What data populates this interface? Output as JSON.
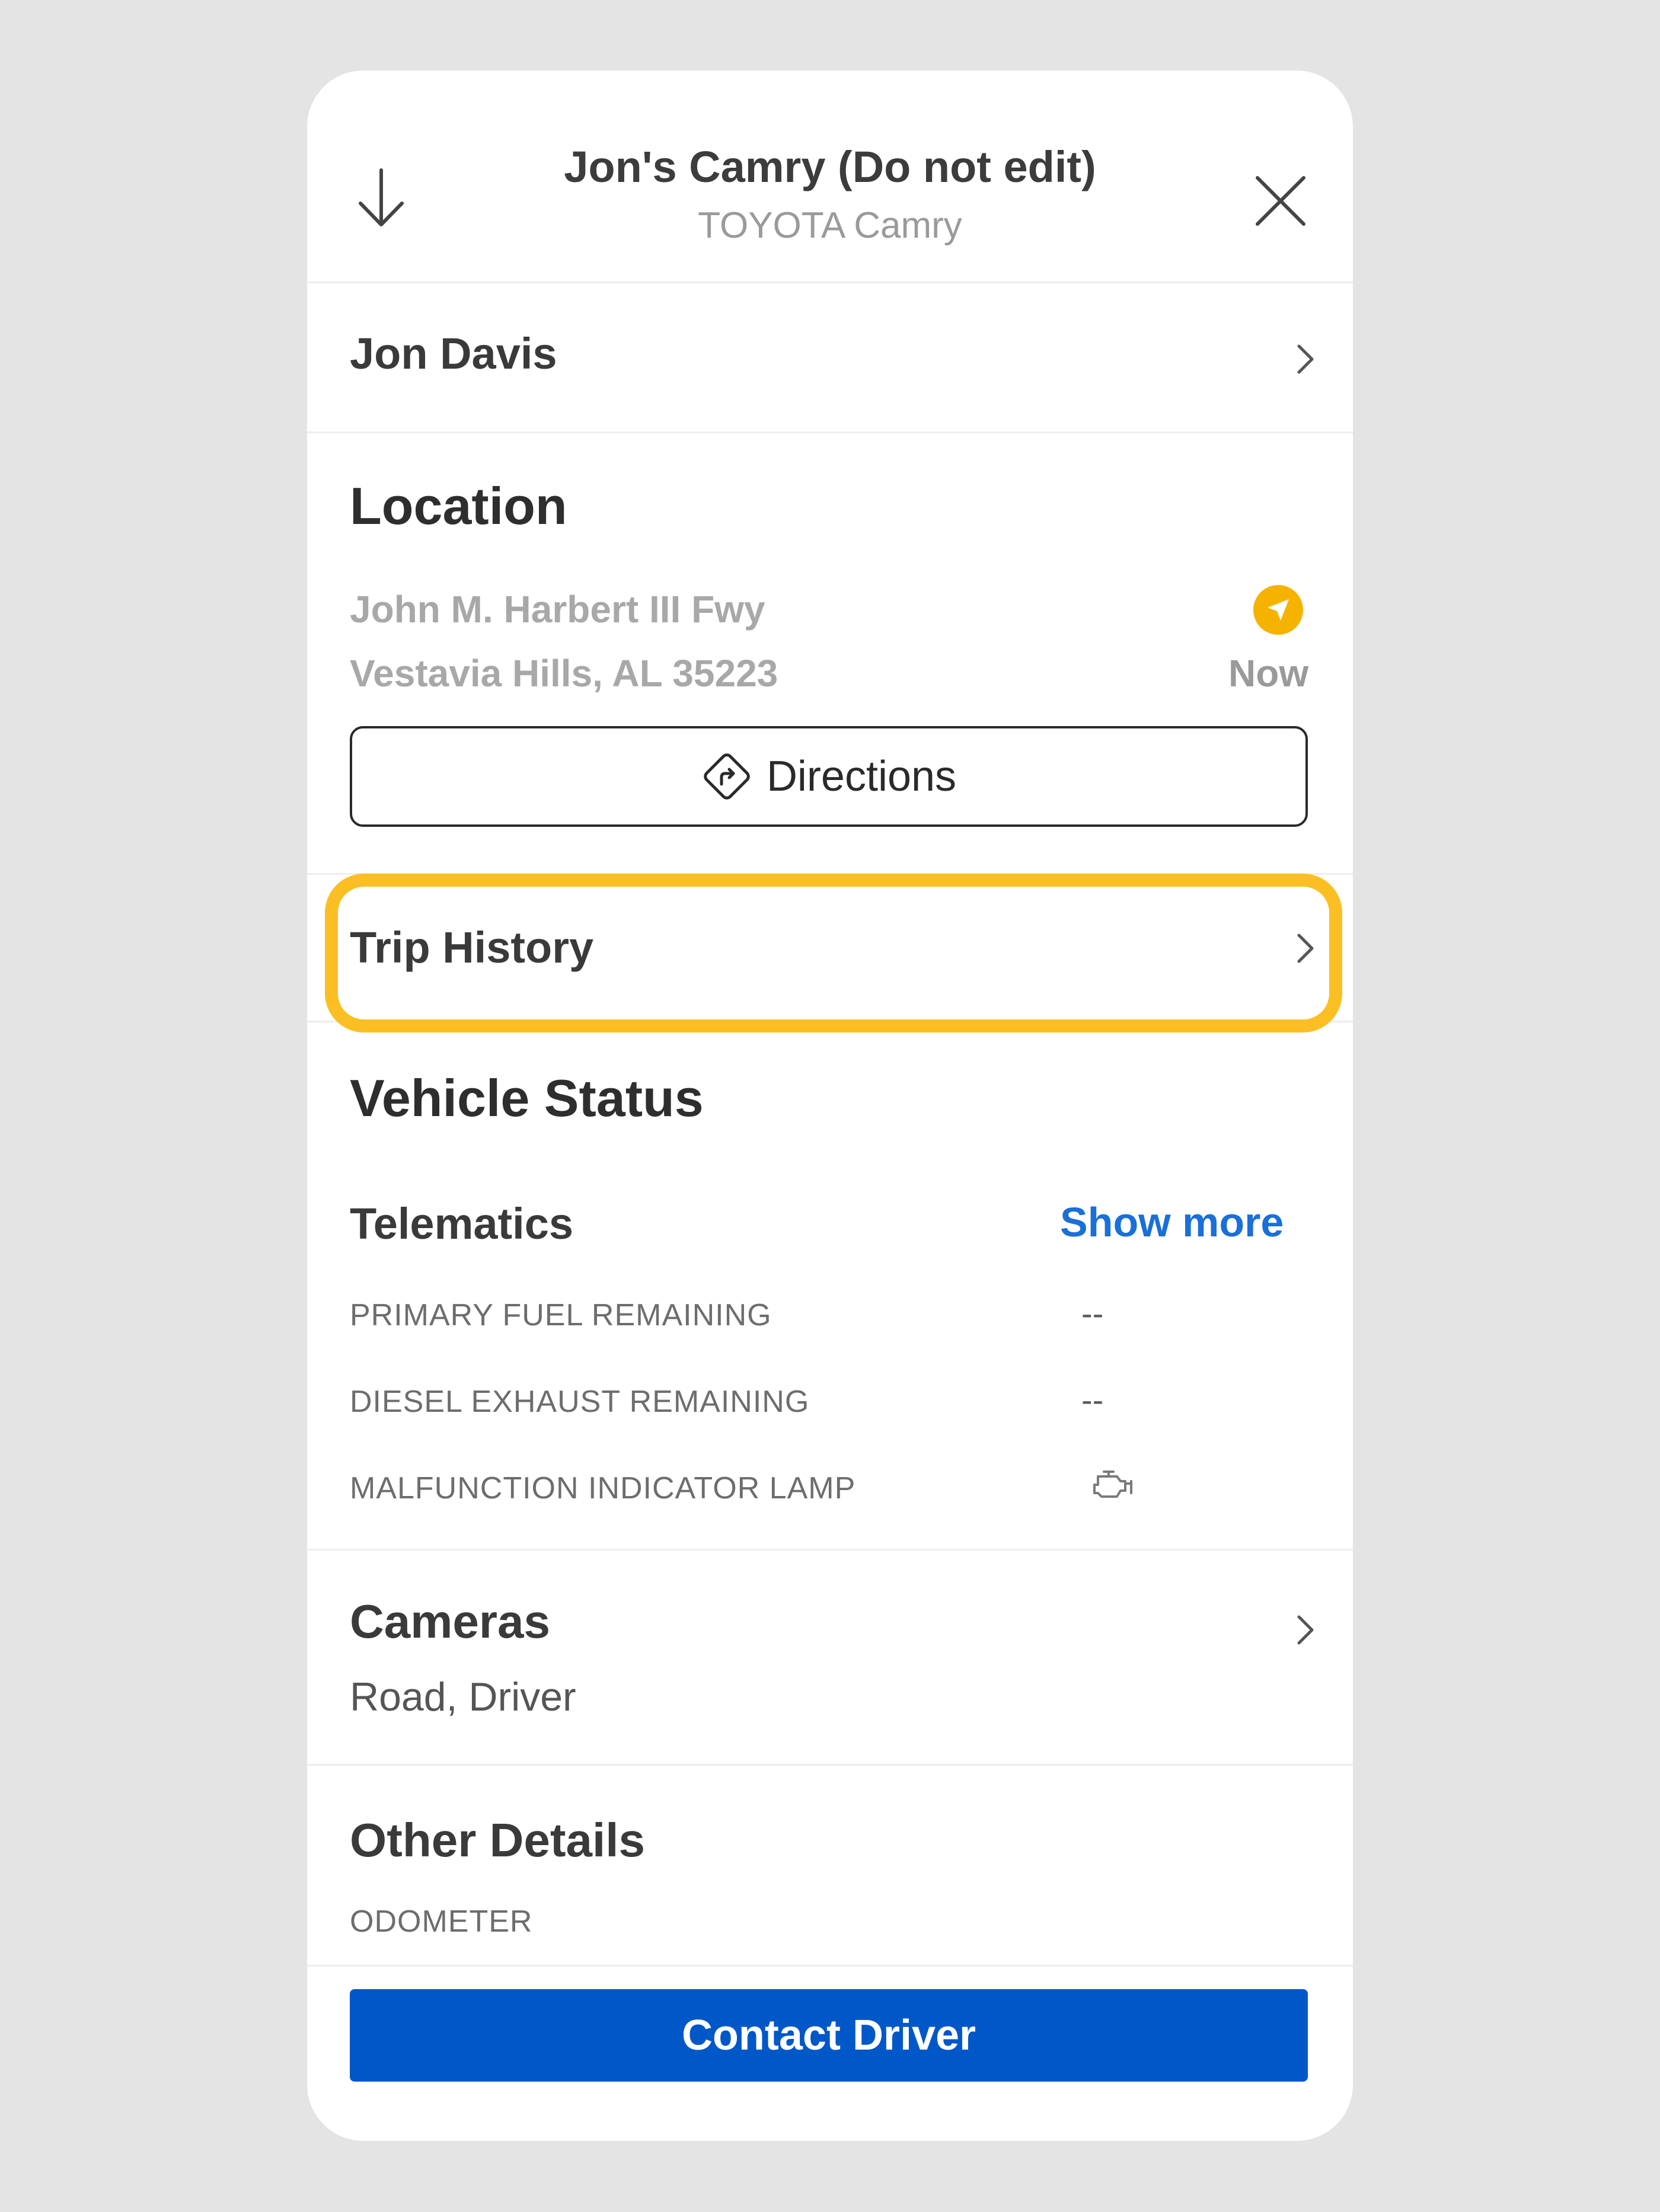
{
  "header": {
    "title": "Jon's Camry (Do not edit)",
    "subtitle": "TOYOTA Camry",
    "collapse_icon": "arrow-down-icon",
    "close_icon": "close-icon"
  },
  "driver": {
    "name": "Jon Davis"
  },
  "location": {
    "heading": "Location",
    "address_line1": "John M. Harbert III Fwy",
    "address_line2": "Vestavia Hills, AL 35223",
    "time_label": "Now",
    "status_icon": "navigation-arrow-icon",
    "status_color": "#f5b300",
    "directions_label": "Directions"
  },
  "trip_history": {
    "label": "Trip History",
    "highlight_color": "#fbbf24"
  },
  "vehicle_status": {
    "heading": "Vehicle Status",
    "telematics_label": "Telematics",
    "show_more_label": "Show more",
    "rows": [
      {
        "label": "PRIMARY FUEL REMAINING",
        "value": "--"
      },
      {
        "label": "DIESEL EXHAUST REMAINING",
        "value": "--"
      },
      {
        "label": "MALFUNCTION INDICATOR LAMP",
        "icon": "engine-icon"
      }
    ]
  },
  "cameras": {
    "heading": "Cameras",
    "value": "Road, Driver"
  },
  "other_details": {
    "heading": "Other Details",
    "odometer_label": "ODOMETER"
  },
  "footer": {
    "contact_label": "Contact Driver",
    "button_color": "#0057c8"
  }
}
